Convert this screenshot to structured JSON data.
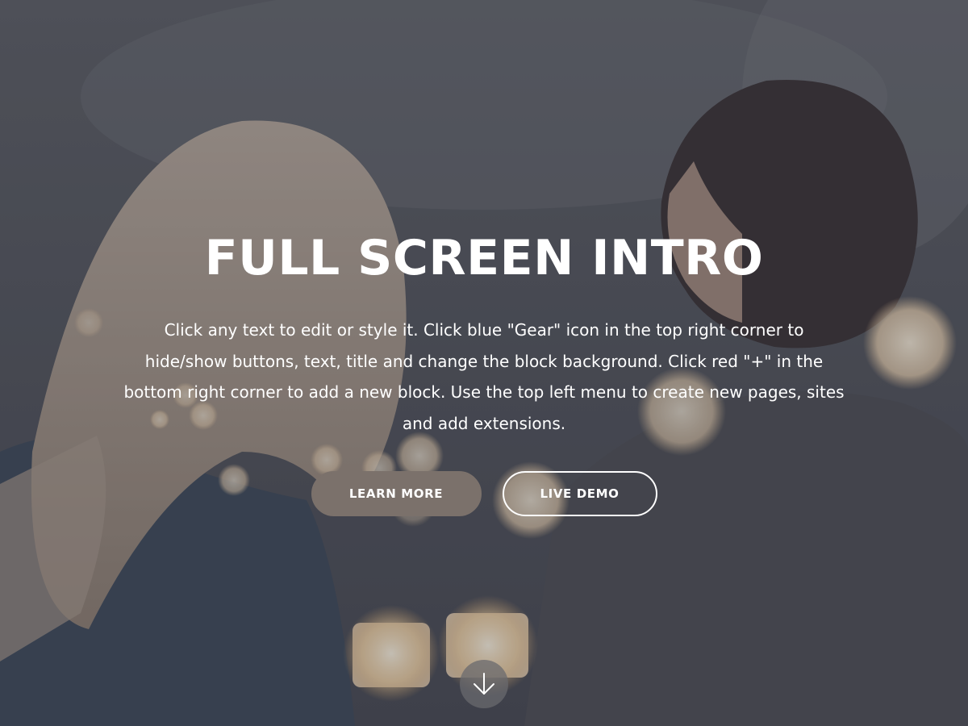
{
  "hero": {
    "title": "FULL SCREEN INTRO",
    "subtitle": "Click any text to edit or style it. Click blue \"Gear\" icon in the top right corner to hide/show buttons, text, title and change the block background. Click red \"+\" in the bottom right corner to add a new block. Use the top left menu to create new pages, sites and add extensions.",
    "buttons": {
      "primary_label": "LEARN MORE",
      "secondary_label": "LIVE DEMO"
    },
    "scroll_icon": "arrow-down-icon"
  },
  "colors": {
    "primary_button": "#7b716b",
    "text": "#ffffff",
    "overlay": "#3c3f4a"
  }
}
